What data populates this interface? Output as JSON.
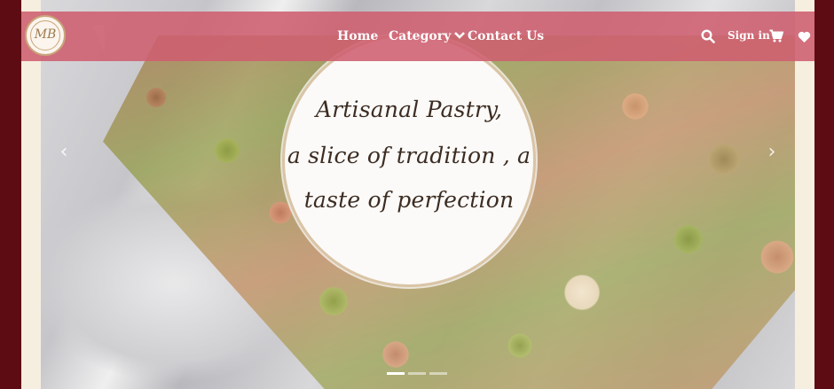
{
  "brand": {
    "logo_text": "MB"
  },
  "nav": {
    "home": "Home",
    "category": "Category",
    "contact": "Contact Us",
    "sign_in": "Sign in"
  },
  "hero": {
    "tagline_line1": "Artisanal Pastry,",
    "tagline_line2": "a slice of tradition , a",
    "tagline_line3": "taste of perfection",
    "slide_count": 3,
    "active_slide": 1
  },
  "icons": {
    "search": "search-icon",
    "cart": "cart-icon",
    "wishlist": "heart-icon",
    "dropdown": "chevron-down-icon"
  },
  "colors": {
    "navbar": "#ce5e70",
    "page_background": "#5e0c14",
    "frame": "#f6eedf",
    "tagline_text": "#3c2c22"
  }
}
